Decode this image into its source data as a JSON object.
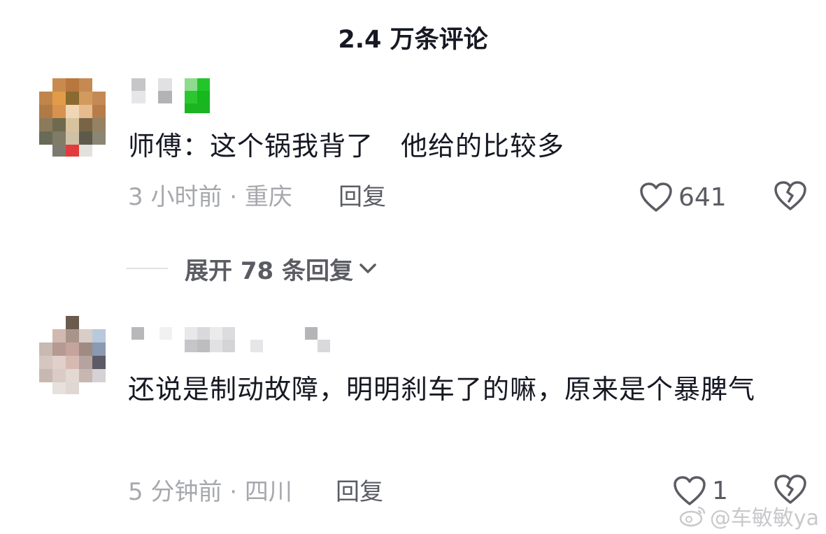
{
  "header": {
    "title": "2.4 万条评论"
  },
  "comments": [
    {
      "text": "师傅：这个锅我背了　他给的比较多",
      "time_location": "3 小时前 · 重庆",
      "reply_label": "回复",
      "like_count": "641",
      "expand_replies_label": "展开 78 条回复"
    },
    {
      "text": "还说是制动故障，明明刹车了的嘛，原来是个暴脾气",
      "time_location": "5 分钟前 · 四川",
      "reply_label": "回复",
      "like_count": "1"
    }
  ],
  "watermark": {
    "text": "@车敏敏ya"
  },
  "icons": {
    "like": "heart-outline-icon",
    "dislike": "broken-heart-icon",
    "expand": "chevron-down-icon",
    "watermark": "weibo-logo-icon"
  },
  "colors": {
    "text": "#161823",
    "meta": "#a7a8ad",
    "action": "#5b5c63",
    "name_badge": "#22c52a"
  }
}
